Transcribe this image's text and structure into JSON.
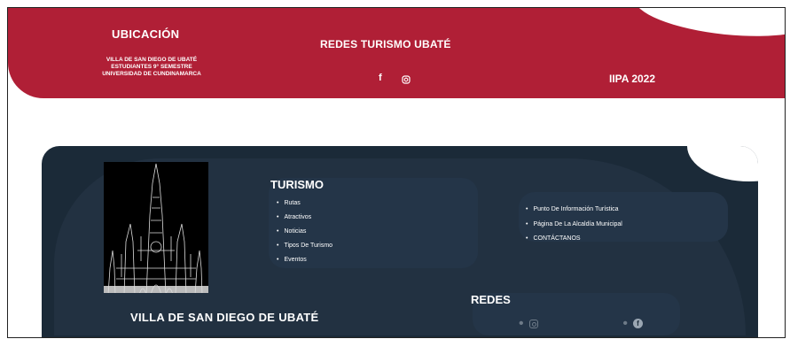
{
  "header": {
    "ubicacion_title": "UBICACIÓN",
    "ubicacion_line1": "VILLA DE SAN DIEGO DE UBATÉ",
    "ubicacion_line2": "ESTUDIANTES 9° SEMESTRE",
    "ubicacion_line3": "UNIVERSIDAD DE CUNDINAMARCA",
    "redes_title": "REDES TURISMO UBATÉ",
    "facebook_glyph": "f",
    "iipa": "IIPA 2022"
  },
  "footer": {
    "turismo_title": "TURISMO",
    "turismo_items": [
      "Rutas",
      "Atractivos",
      "Noticias",
      "Tipos De Turismo",
      "Eventos"
    ],
    "links": [
      "Punto De Información Turística",
      "Página De La Alcaldía Municipal",
      "CONTÁCTANOS"
    ],
    "town_name": "VILLA DE SAN DIEGO DE UBATÉ",
    "redes_title": "REDES"
  },
  "colors": {
    "header_red": "#b01f36",
    "footer_dark": "#1b2a38"
  },
  "icons": [
    "facebook-icon",
    "instagram-icon",
    "cathedral-image"
  ]
}
